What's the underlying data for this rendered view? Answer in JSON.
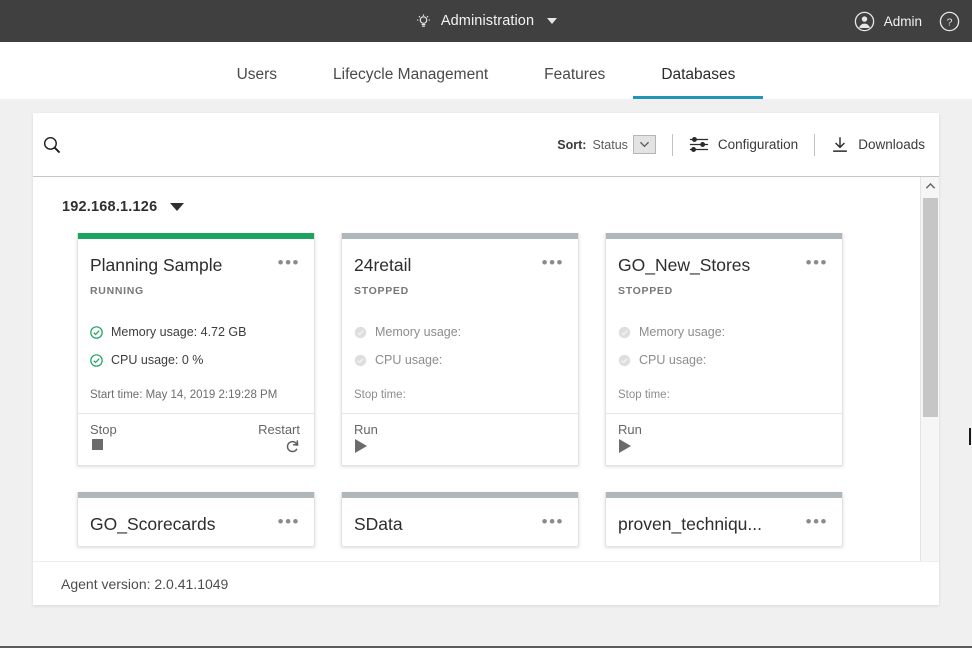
{
  "topbar": {
    "admin_icon": "settings-bulb-icon",
    "title": "Administration",
    "dropdown_icon": "caret-down-icon",
    "user_icon": "avatar-icon",
    "user_name": "Admin",
    "help_icon": "help-circle-icon",
    "background": "#404040"
  },
  "tabs": [
    {
      "label": "Users",
      "active": false
    },
    {
      "label": "Lifecycle Management",
      "active": false
    },
    {
      "label": "Features",
      "active": false
    },
    {
      "label": "Databases",
      "active": true
    }
  ],
  "tab_accent": "#2196b8",
  "toolbar": {
    "search_icon": "search-icon",
    "search_value": "",
    "search_placeholder": "",
    "sort_label": "Sort:",
    "sort_value": "Status",
    "sort_caret": "chevron-down-icon",
    "configuration_icon": "sliders-icon",
    "configuration_label": "Configuration",
    "downloads_icon": "download-icon",
    "downloads_label": "Downloads"
  },
  "host": {
    "name": "192.168.1.126",
    "caret_icon": "caret-down-icon"
  },
  "cards": [
    {
      "name": "Planning Sample",
      "status": "RUNNING",
      "state": "running",
      "accent": "#1ba35f",
      "kebab_icon": "more-options-icon",
      "memory_label": "Memory usage: 4.72 GB",
      "cpu_label": "CPU usage: 0 %",
      "memory_icon": "check-circle-icon",
      "cpu_icon": "check-circle-icon",
      "time_label": "Start time: May 14, 2019 2:19:28 PM",
      "actions": [
        {
          "label": "Stop",
          "icon": "stop-square-icon",
          "align": "left"
        },
        {
          "label": "Restart",
          "icon": "restart-icon",
          "align": "right"
        }
      ]
    },
    {
      "name": "24retail",
      "status": "STOPPED",
      "state": "stopped",
      "accent": "#b0b7ba",
      "kebab_icon": "more-options-icon",
      "memory_label": "Memory usage:",
      "cpu_label": "CPU usage:",
      "memory_icon": "check-circle-disabled-icon",
      "cpu_icon": "check-circle-disabled-icon",
      "time_label": "Stop time:",
      "actions": [
        {
          "label": "Run",
          "icon": "play-icon",
          "align": "left"
        }
      ]
    },
    {
      "name": "GO_New_Stores",
      "status": "STOPPED",
      "state": "stopped",
      "accent": "#b0b7ba",
      "kebab_icon": "more-options-icon",
      "memory_label": "Memory usage:",
      "cpu_label": "CPU usage:",
      "memory_icon": "check-circle-disabled-icon",
      "cpu_icon": "check-circle-disabled-icon",
      "time_label": "Stop time:",
      "actions": [
        {
          "label": "Run",
          "icon": "play-icon",
          "align": "left"
        }
      ]
    }
  ],
  "cards_row2": [
    {
      "name": "GO_Scorecards",
      "accent": "#b0b7ba",
      "kebab_icon": "more-options-icon"
    },
    {
      "name": "SData",
      "accent": "#b0b7ba",
      "kebab_icon": "more-options-icon"
    },
    {
      "name": "proven_techniqu...",
      "accent": "#b0b7ba",
      "kebab_icon": "more-options-icon"
    }
  ],
  "scrollbar": {
    "up_icon": "chevron-up-icon",
    "down_icon": "chevron-down-icon"
  },
  "footer": {
    "agent_version": "Agent version: 2.0.41.1049"
  }
}
